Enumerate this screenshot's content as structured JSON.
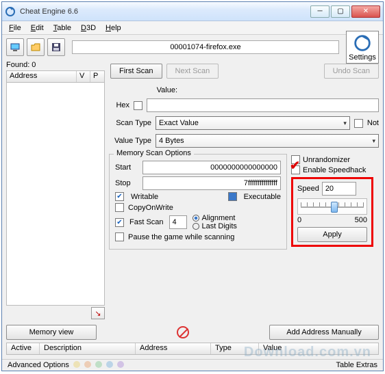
{
  "window": {
    "title": "Cheat Engine 6.6"
  },
  "menu": {
    "file": "File",
    "edit": "Edit",
    "table": "Table",
    "d3d": "D3D",
    "help": "Help"
  },
  "toolbar": {
    "process": "00001074-firefox.exe",
    "settings": "Settings"
  },
  "left": {
    "found": "Found: 0",
    "cols": {
      "address": "Address",
      "v": "V",
      "p": "P"
    }
  },
  "scan": {
    "first": "First Scan",
    "next": "Next Scan",
    "undo": "Undo Scan",
    "value_lbl": "Value:",
    "hex_lbl": "Hex",
    "scantype_lbl": "Scan Type",
    "scantype": "Exact Value",
    "not": "Not",
    "valuetype_lbl": "Value Type",
    "valuetype": "4 Bytes"
  },
  "memopts": {
    "legend": "Memory Scan Options",
    "start_lbl": "Start",
    "start": "0000000000000000",
    "stop_lbl": "Stop",
    "stop": "7fffffffffffffff",
    "writable": "Writable",
    "executable": "Executable",
    "copyonwrite": "CopyOnWrite",
    "fastscan": "Fast Scan",
    "fastscan_val": "4",
    "alignment": "Alignment",
    "lastdigits": "Last Digits",
    "pause": "Pause the game while scanning"
  },
  "rightcol": {
    "unrandomizer": "Unrandomizer",
    "enable_speedhack": "Enable Speedhack",
    "speed_lbl": "Speed",
    "speed_val": "20",
    "min": "0",
    "max": "500",
    "apply": "Apply"
  },
  "bottom": {
    "memview": "Memory view",
    "addaddr": "Add Address Manually",
    "cols": {
      "active": "Active",
      "desc": "Description",
      "address": "Address",
      "type": "Type",
      "value": "Value"
    },
    "advopts": "Advanced Options",
    "extras": "Table Extras"
  },
  "watermark": "Download.com.vn"
}
